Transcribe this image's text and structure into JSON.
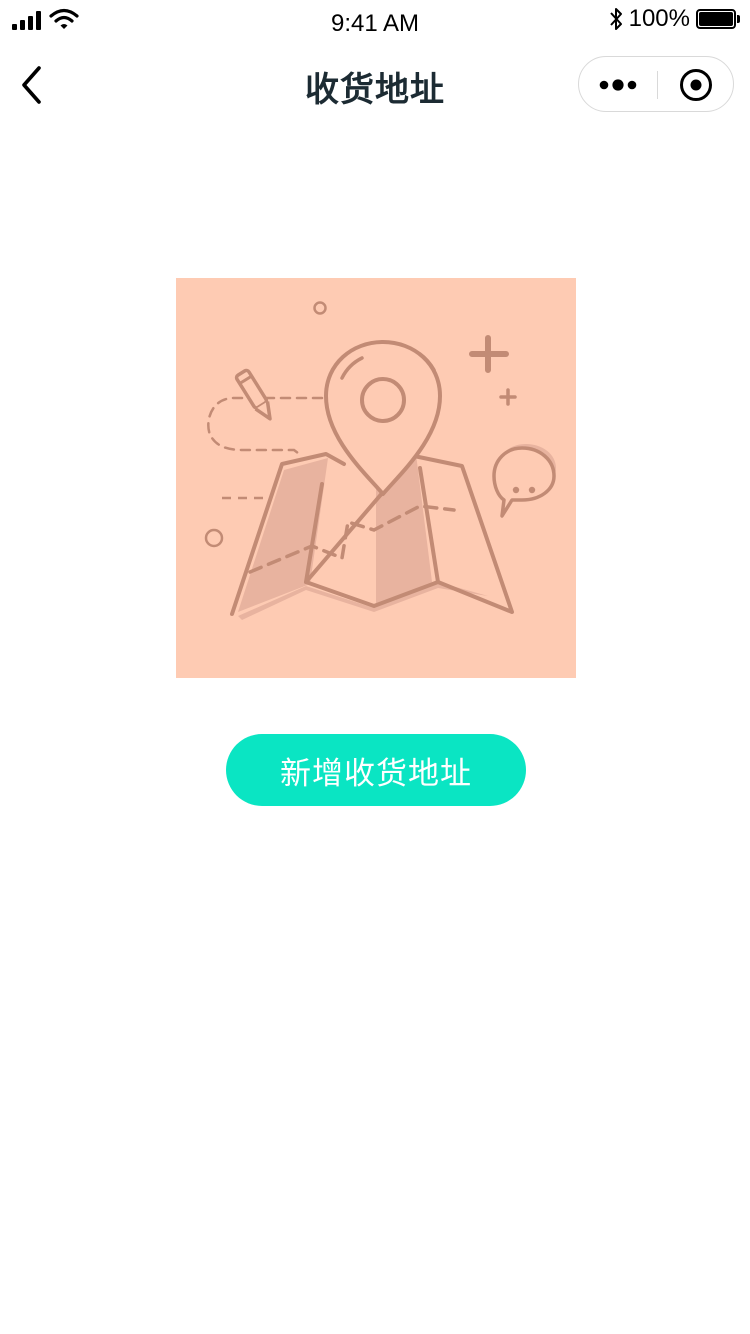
{
  "status_bar": {
    "time": "9:41 AM",
    "battery_percent": "100%",
    "icons": [
      "signal-icon",
      "wifi-icon",
      "bluetooth-icon",
      "battery-icon"
    ]
  },
  "nav": {
    "title": "收货地址",
    "icons": [
      "back-arrow-icon",
      "more-dots-icon",
      "close-target-icon"
    ]
  },
  "empty_state": {
    "illustration": "map-location-pin-illustration",
    "background_color": "#fecbb3",
    "line_color": "#c28b75"
  },
  "actions": {
    "add_address_label": "新增收货地址",
    "button_color": "#0ae5c3"
  }
}
